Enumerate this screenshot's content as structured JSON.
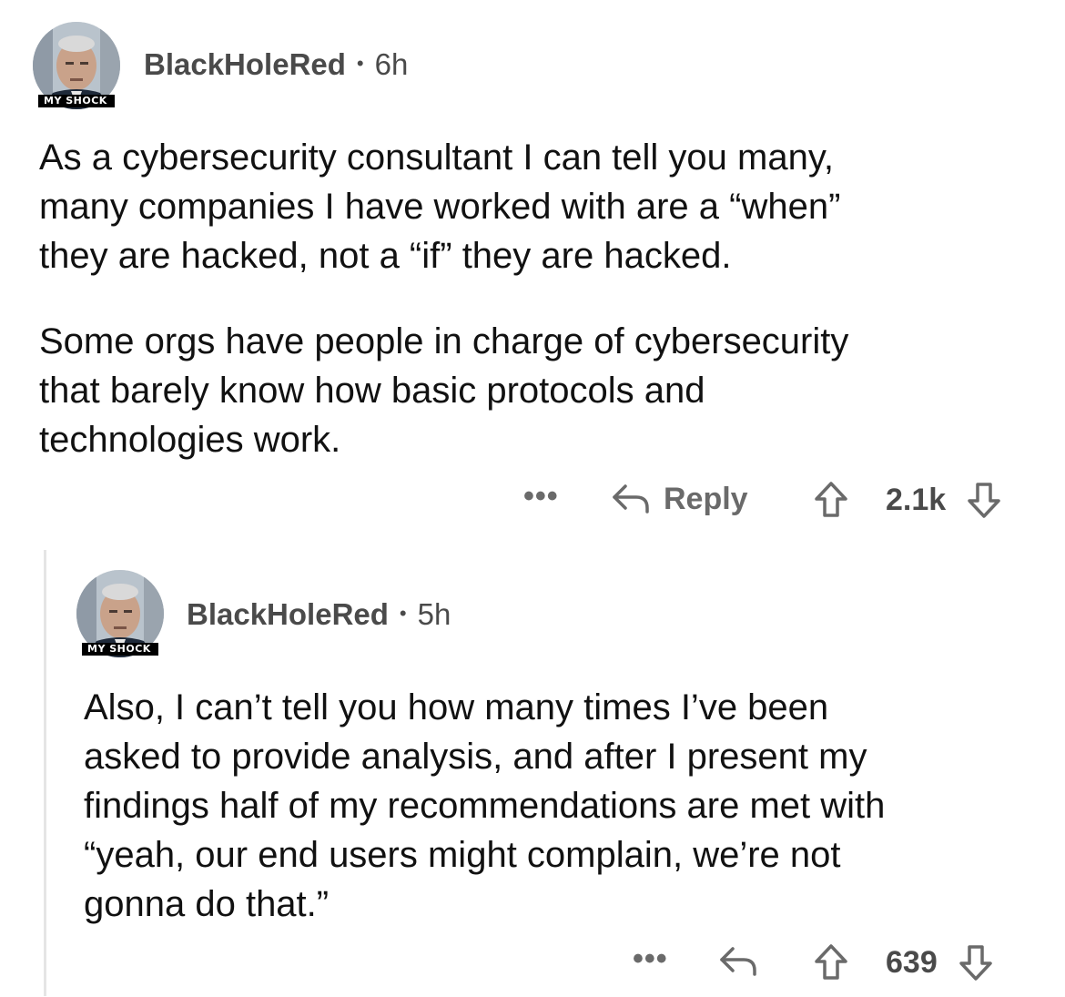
{
  "comments": [
    {
      "username": "BlackHoleRed",
      "separator": "•",
      "time": "6h",
      "avatar_tag": "MY SHOCK",
      "paragraphs": [
        "As a cybersecurity consultant I can tell you many,\nmany companies I have worked with are a “when”\nthey are hacked, not a “if” they are hacked.",
        "Some orgs have people in charge of cybersecurity\nthat barely know how basic protocols and\ntechnologies work."
      ],
      "actions": {
        "more": "•••",
        "reply_label": "Reply",
        "score": "2.1k",
        "icons": [
          "more-icon",
          "reply-arrow-icon",
          "upvote-icon",
          "downvote-icon"
        ]
      }
    },
    {
      "username": "BlackHoleRed",
      "separator": "•",
      "time": "5h",
      "avatar_tag": "MY SHOCK",
      "paragraphs": [
        "Also, I can’t tell you how many times I’ve been\nasked to provide analysis, and after I present my\nfindings half of my recommendations are met with\n“yeah, our end users might complain, we’re not\ngonna do that.”"
      ],
      "actions": {
        "more": "•••",
        "score": "639",
        "icons": [
          "more-icon",
          "reply-arrow-icon",
          "upvote-icon",
          "downvote-icon"
        ]
      }
    }
  ],
  "colors": {
    "meta_text": "#4a4a4a",
    "body_text": "#111111",
    "action_text": "#6a6a6a",
    "thread_line": "#e5e5e5"
  }
}
